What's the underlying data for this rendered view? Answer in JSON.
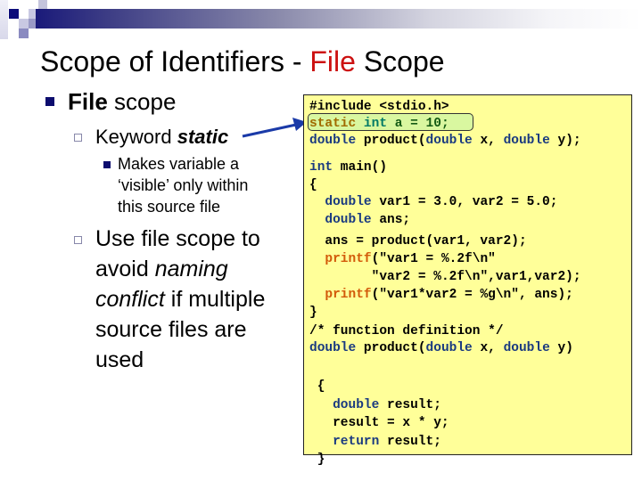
{
  "slide": {
    "title": {
      "prefix": "Scope of Identifiers - ",
      "accent": "File",
      "suffix": " Scope",
      "accent_color": "#cc1111"
    },
    "bullets": {
      "level1": {
        "bold": "File",
        "rest": " scope"
      },
      "level2_a": {
        "text": "Keyword ",
        "emphasis": "static"
      },
      "level3": {
        "lines": [
          "Makes variable a",
          "‘visible’ only within",
          "this source file"
        ]
      },
      "level2_b": {
        "line1": "Use file scope to",
        "line2_prefix": "avoid ",
        "line2_italic": "naming",
        "line3_italic": "conflict",
        "line3_suffix": " if multiple",
        "line4": "source files are",
        "line5": "used"
      }
    },
    "icons": {
      "level1_bullet": "filled-square-bullet-icon",
      "level2_bullet": "hollow-square-bullet-icon",
      "level3_bullet": "small-filled-square-bullet-icon",
      "arrow": "arrow-right-icon"
    },
    "colors": {
      "code_background": "#ffff99",
      "highlight_background": "#d9f7a0",
      "keyword": "#1a3a80",
      "function_call": "#d25a0a",
      "bullet": "#0c0c6e"
    },
    "code": {
      "include": "#include <stdio.h>",
      "static_kw": "static",
      "int_kw": "int",
      "static_rest": " a = 10;",
      "proto": {
        "kw1": "double",
        "mid1": " product(",
        "kw2": "double",
        "mid2": " x, ",
        "kw3": "double",
        "end": " y);"
      },
      "main_kw": "int",
      "main_rest": " main()",
      "open_brace": "{",
      "decl1": {
        "kw": "double",
        "rest": " var1 = 3.0, var2 = 5.0;"
      },
      "decl2": {
        "kw": "double",
        "rest": " ans;"
      },
      "assign": "ans = product(var1, var2);",
      "printf1": {
        "fn": "printf",
        "rest": "(\"var1 = %.2f\\n\""
      },
      "printf1_cont": "\"var2 = %.2f\\n\",var1,var2);",
      "printf2": {
        "fn": "printf",
        "rest": "(\"var1*var2 = %g\\n\", ans);"
      },
      "close_brace": "}",
      "comment": "/* function definition */",
      "def": {
        "kw1": "double",
        "mid1": " product(",
        "kw2": "double",
        "mid2": " x, ",
        "kw3": "double",
        "end": " y)"
      },
      "def_open": "{",
      "body1": {
        "kw": "double",
        "rest": " result;"
      },
      "body2": "result = x * y;",
      "body3": {
        "kw": "return",
        "rest": " result;"
      },
      "def_close": "}"
    }
  }
}
